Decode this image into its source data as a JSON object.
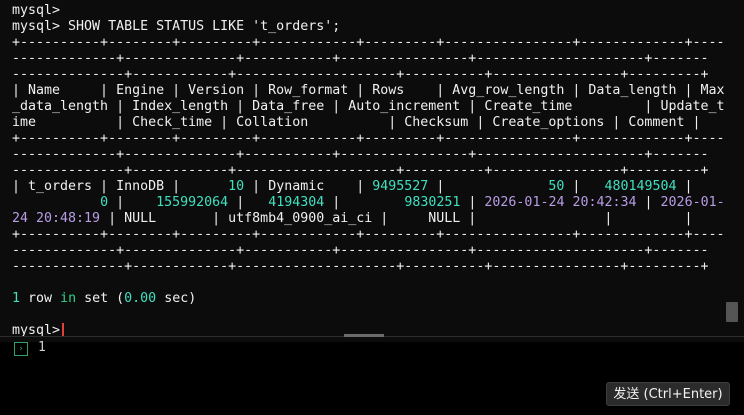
{
  "terminal": {
    "prompt_line": "mysql>",
    "command_line": "mysql> SHOW TABLE STATUS LIKE 't_orders';",
    "border_a": "+----------+--------+---------+------------+---------+----------------+-------------+----",
    "border_b": "-------------+--------------+-----------+----------------+---------------------+-------",
    "border_c": "--------------+------------+--------------------+----------+----------------+---------+",
    "header_1": "| Name     | Engine | Version | Row_format | Rows    | Avg_row_length | Data_length | Max",
    "header_2": "_data_length | Index_length | Data_free | Auto_increment | Create_time         | Update_t",
    "header_3": "ime          | Check_time | Collation          | Checksum | Create_options | Comment |",
    "row_1": {
      "a": "| t_orders | InnoDB |      ",
      "version": "10",
      "b": " | Dynamic    | ",
      "rows": "9495527",
      "c": " |             ",
      "avg": "50",
      "d": " |   ",
      "data_length": "480149504",
      "e": " |"
    },
    "row_2": {
      "a": "           ",
      "max_data": "0",
      "b": " |    ",
      "index_length": "155992064",
      "c": " |   ",
      "data_free": "4194304",
      "d": " |        ",
      "auto_inc": "9830251",
      "e": " | ",
      "create_time": "2026-01-24 20:42:34",
      "f": " | ",
      "update_a": "2026-01-"
    },
    "row_3": {
      "update_b": "24 20:48:19",
      "a": " | NULL       | utf8mb4_0900_ai_ci |     NULL |                |         |"
    },
    "result_line": {
      "count": "1",
      "row": "row",
      "in": "in",
      "set": "set",
      "time": "0.00",
      "sec": "sec"
    },
    "final_prompt": "mysql>"
  },
  "input_pane": {
    "line_number": "1",
    "send_label": "发送 (Ctrl+Enter)"
  }
}
